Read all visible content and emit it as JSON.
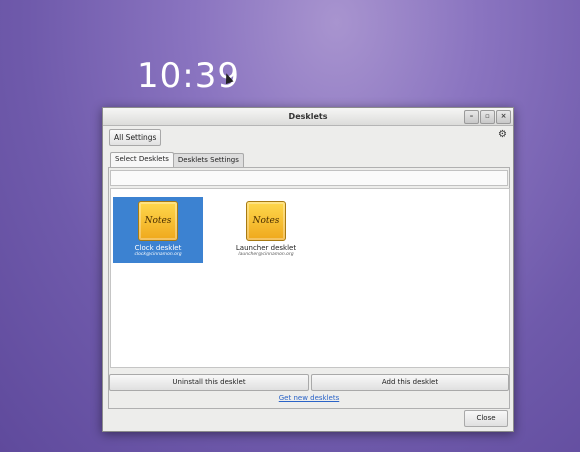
{
  "desktop": {
    "clock": "10:39"
  },
  "window": {
    "title": "Desklets",
    "controls": [
      {
        "icon": "minimize-icon",
        "glyph": "–"
      },
      {
        "icon": "maximize-icon",
        "glyph": "▫"
      },
      {
        "icon": "close-icon",
        "glyph": "×"
      }
    ]
  },
  "toolbar": {
    "all_settings_label": "All Settings",
    "settings_icon": "gear-icon"
  },
  "tabs": [
    {
      "label": "Select Desklets",
      "active": true
    },
    {
      "label": "Desklets Settings",
      "active": false
    }
  ],
  "desklets": [
    {
      "name": "Clock desklet",
      "uuid": "clock@cinnamon.org",
      "icon_text": "Notes",
      "selected": true
    },
    {
      "name": "Launcher desklet",
      "uuid": "launcher@cinnamon.org",
      "icon_text": "Notes",
      "selected": false
    }
  ],
  "actions": {
    "uninstall_label": "Uninstall this desklet",
    "add_label": "Add this desklet",
    "get_new_link": "Get new desklets",
    "close_label": "Close"
  }
}
